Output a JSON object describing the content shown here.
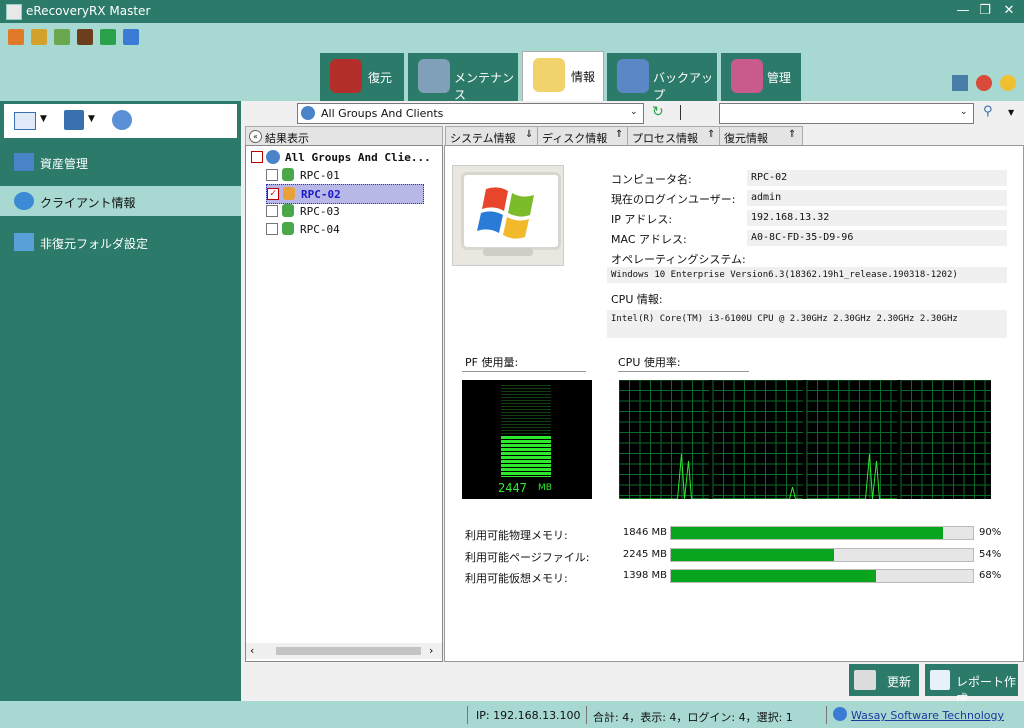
{
  "window": {
    "title": "eRecoveryRX Master"
  },
  "toolbar_icons": [
    "user-icon",
    "folder-icon",
    "note-icon",
    "book-icon",
    "refresh-icon",
    "network-icon"
  ],
  "tabs": [
    {
      "label": "復元",
      "icon": "restore-icon"
    },
    {
      "label": "メンテナンス",
      "icon": "maintenance-icon"
    },
    {
      "label": "情報",
      "icon": "info-icon",
      "active": true
    },
    {
      "label": "バックアップ",
      "icon": "backup-icon"
    },
    {
      "label": "管理",
      "icon": "admin-icon"
    }
  ],
  "sidebar": {
    "items": [
      {
        "label": "資産管理",
        "icon": "asset-icon"
      },
      {
        "label": "クライアント情報",
        "icon": "client-icon",
        "active": true
      },
      {
        "label": "非復元フォルダ設定",
        "icon": "folder-settings-icon"
      }
    ]
  },
  "group_combo": {
    "value": "All Groups And Clients"
  },
  "search_combo": {
    "value": ""
  },
  "tree": {
    "header": "結果表示",
    "root": "All Groups And Clie...",
    "clients": [
      {
        "name": "RPC-01",
        "checked": false
      },
      {
        "name": "RPC-02",
        "checked": true,
        "selected": true
      },
      {
        "name": "RPC-03",
        "checked": false
      },
      {
        "name": "RPC-04",
        "checked": false
      }
    ]
  },
  "subtabs": [
    "システム情報",
    "ディスク情報",
    "プロセス情報",
    "復元情報"
  ],
  "system_info": {
    "computer_name_label": "コンピュータ名:",
    "computer_name": "RPC-02",
    "login_user_label": "現在のログインユーザー:",
    "login_user": "admin",
    "ip_label": "IP アドレス:",
    "ip": "192.168.13.32",
    "mac_label": "MAC アドレス:",
    "mac": "A0-8C-FD-35-D9-96",
    "os_label": "オペレーティングシステム:",
    "os": "Windows 10 Enterprise Version6.3(18362.19h1_release.190318-1202)",
    "cpu_label": "CPU 情報:",
    "cpu": "Intel(R) Core(TM) i3-6100U CPU @ 2.30GHz  2.30GHz  2.30GHz  2.30GHz"
  },
  "pf_usage": {
    "label": "PF 使用量:",
    "value_text": "2447",
    "unit": "MB",
    "fill_fraction": 0.45
  },
  "cpu_usage": {
    "label": "CPU 使用率:",
    "cores": 4
  },
  "memory": [
    {
      "label": "利用可能物理メモリ:",
      "value": "1846 MB",
      "percent_text": "90%",
      "percent": 90
    },
    {
      "label": "利用可能ページファイル:",
      "value": "2245 MB",
      "percent_text": "54%",
      "percent": 54
    },
    {
      "label": "利用可能仮想メモリ:",
      "value": "1398 MB",
      "percent_text": "68%",
      "percent": 68
    }
  ],
  "buttons": {
    "refresh": "更新",
    "report": "レポート作成"
  },
  "status": {
    "ip": "IP:  192.168.13.100",
    "summary": "合計:   4，表示:   4，ログイン:   4，選択:   1",
    "company": "Wasay Software Technology"
  },
  "colors": {
    "teal": "#2b7a6a",
    "light_teal": "#a7d8d2",
    "green": "#0aa51f",
    "graph_green": "#2ee82e"
  }
}
